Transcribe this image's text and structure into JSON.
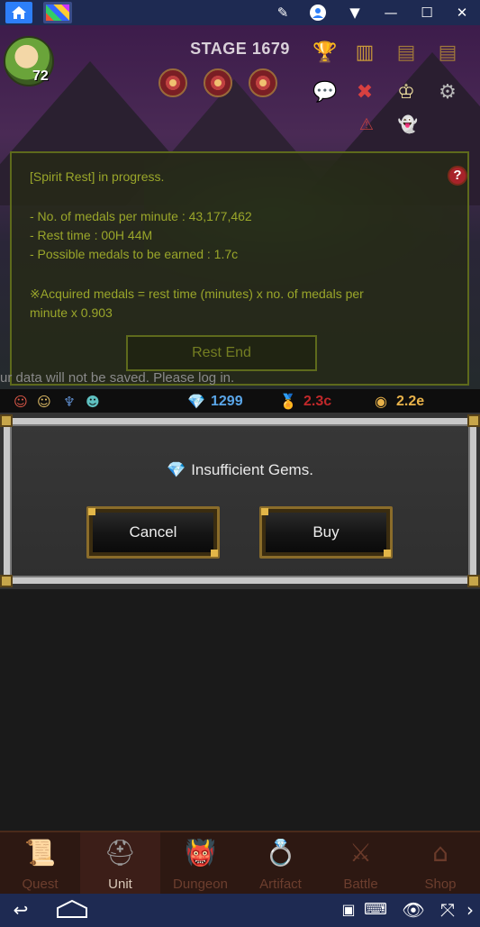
{
  "emulator": {
    "icons": [
      "home-icon",
      "app-tab-icon",
      "brush-icon",
      "account-icon",
      "dropdown-icon",
      "minimize-icon",
      "maximize-icon",
      "close-icon"
    ]
  },
  "game": {
    "stage_title": "STAGE 1679",
    "player_level": "72",
    "spirit_rest": {
      "status": "[Spirit Rest] in progress.",
      "medals_per_minute": "- No. of medals per minute : 43,177,462",
      "rest_time": "- Rest time : 00H 44M",
      "possible_medals": "- Possible medals to be earned : 1.7c",
      "formula_line1": "※Acquired medals = rest time (minutes) x no. of medals per",
      "formula_line2": "minute x 0.903",
      "rest_end_label": "Rest End",
      "help_label": "?"
    },
    "login_notice": "ur data will not be saved. Please log in."
  },
  "resources": {
    "gems": "1299",
    "medals": "2.3c",
    "gold": "2.2e",
    "colors": {
      "gems": "#5aa6e8",
      "medals": "#c0282a",
      "gold": "#e8b24a"
    }
  },
  "dialog": {
    "message": "Insufficient Gems.",
    "cancel_label": "Cancel",
    "buy_label": "Buy"
  },
  "nav": {
    "items": [
      {
        "label": "Quest",
        "icon": "scroll-icon",
        "active": false
      },
      {
        "label": "Unit",
        "icon": "helmet-icon",
        "active": true
      },
      {
        "label": "Dungeon",
        "icon": "monster-icon",
        "active": false
      },
      {
        "label": "Artifact",
        "icon": "ring-icon",
        "active": false
      },
      {
        "label": "Battle",
        "icon": "swords-icon",
        "active": false
      },
      {
        "label": "Shop",
        "icon": "shop-icon",
        "active": false
      }
    ]
  },
  "android_bar": {
    "icons": [
      "back-icon",
      "home-icon",
      "keyboard-icon",
      "eye-icon",
      "fullscreen-icon",
      "chevron-right-icon"
    ]
  }
}
